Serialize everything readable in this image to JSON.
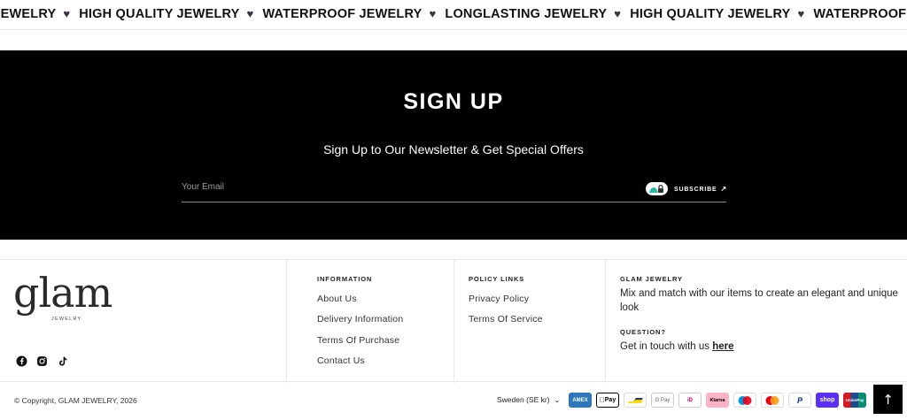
{
  "marquee": {
    "items": [
      "NG JEWELRY",
      "HIGH QUALITY JEWELRY",
      "WATERPROOF JEWELRY",
      "LONGLASTING JEWELRY",
      "HIGH QUALITY JEWELRY",
      "WATERPROOF JEWELRY"
    ],
    "separator_icon": "heart-icon",
    "separator_color": "#3b3047"
  },
  "signup": {
    "title": "SIGN UP",
    "subtitle": "Sign Up to Our Newsletter & Get Special Offers",
    "email_placeholder": "Your Email",
    "subscribe_label": "SUBSCRIBE",
    "subscribe_icon": "arrow-up-right-icon",
    "background": "#000000"
  },
  "brand": {
    "logo_text": "glam",
    "logo_subtext": "JEWELRY",
    "social_icons": [
      "facebook-icon",
      "instagram-icon",
      "tiktok-icon"
    ]
  },
  "information": {
    "heading": "INFORMATION",
    "links": [
      "About Us",
      "Delivery Information",
      "Terms Of Purchase",
      "Contact Us"
    ]
  },
  "policy": {
    "heading": "POLICY LINKS",
    "links": [
      "Privacy Policy",
      "Terms Of Service"
    ]
  },
  "about": {
    "heading": "GLAM JEWELRY",
    "text": "Mix and match with our items to create an elegant and unique look",
    "question_heading": "QUESTION?",
    "contact_text": "Get in touch with us",
    "contact_link": "here"
  },
  "bottom": {
    "copyright": "© Copyright, GLAM JEWELRY, 2026",
    "currency": "Sweden (SE kr)",
    "payments": [
      {
        "name": "American Express",
        "label": "AMEX",
        "color": "#2e77bb"
      },
      {
        "name": "Apple Pay",
        "label": "Pay",
        "color": "#000000"
      },
      {
        "name": "Bancontact",
        "label": "",
        "color": "#1e3764"
      },
      {
        "name": "Google Pay",
        "label": "G Pay",
        "color": "#5f6368"
      },
      {
        "name": "iDEAL",
        "label": "iD",
        "color": "#cc0066"
      },
      {
        "name": "Klarna",
        "label": "Klarna",
        "color": "#ffb3c7"
      },
      {
        "name": "Maestro",
        "label": "",
        "color": "#0099df"
      },
      {
        "name": "Mastercard",
        "label": "",
        "color": "#eb001b"
      },
      {
        "name": "PayPal",
        "label": "P",
        "color": "#003087"
      },
      {
        "name": "Shop Pay",
        "label": "shop",
        "color": "#5a31f4"
      },
      {
        "name": "UnionPay",
        "label": "UnionPay",
        "color": "#d7191f"
      }
    ],
    "back_to_top_icon": "arrow-up-icon"
  }
}
